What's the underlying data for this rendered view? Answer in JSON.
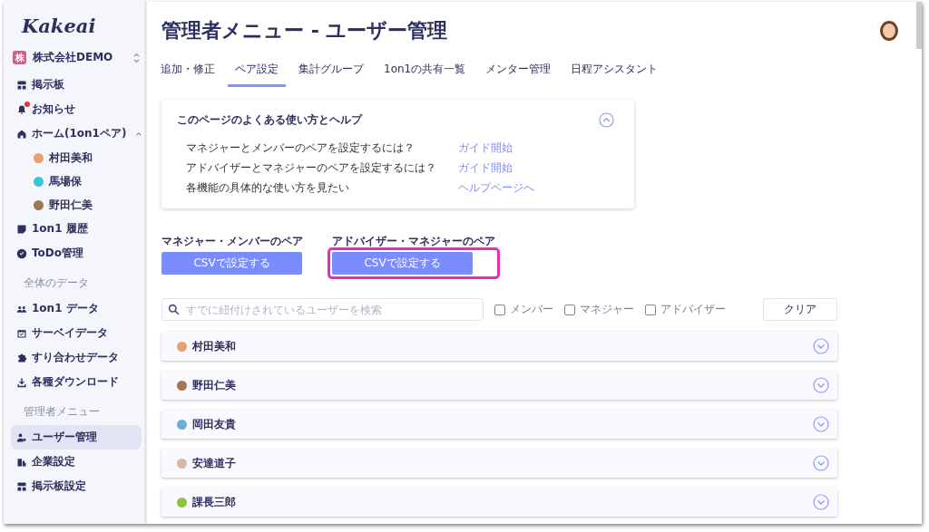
{
  "sidebar": {
    "logo": "Kakeai",
    "company": {
      "badge": "株",
      "name": "株式会社DEMO"
    },
    "items": [
      {
        "kind": "item",
        "label": "掲示板",
        "selected": false
      },
      {
        "kind": "item",
        "label": "お知らせ",
        "selected": false,
        "notification": true
      },
      {
        "kind": "item",
        "label": "ホーム(1on1ペア)",
        "selected": false,
        "expanded": true,
        "children": [
          {
            "label": "村田美和",
            "color": "#e8a070"
          },
          {
            "label": "馬場保",
            "color": "#3cc4d4"
          },
          {
            "label": "野田仁美",
            "color": "#a07850"
          }
        ]
      },
      {
        "kind": "item",
        "label": "1on1 履歴",
        "selected": false
      },
      {
        "kind": "item",
        "label": "ToDo管理",
        "selected": false
      },
      {
        "kind": "heading",
        "label": "全体のデータ"
      },
      {
        "kind": "item",
        "label": "1on1 データ",
        "selected": false
      },
      {
        "kind": "item",
        "label": "サーベイデータ",
        "selected": false
      },
      {
        "kind": "item",
        "label": "すり合わせデータ",
        "selected": false
      },
      {
        "kind": "item",
        "label": "各種ダウンロード",
        "selected": false
      },
      {
        "kind": "heading",
        "label": "管理者メニュー"
      },
      {
        "kind": "item",
        "label": "ユーザー管理",
        "selected": true
      },
      {
        "kind": "item",
        "label": "企業設定",
        "selected": false
      },
      {
        "kind": "item",
        "label": "掲示板設定",
        "selected": false
      }
    ]
  },
  "page_title": "管理者メニュー - ユーザー管理",
  "tabs": [
    {
      "label": "追加・修正",
      "selected": false
    },
    {
      "label": "ペア設定",
      "selected": true
    },
    {
      "label": "集計グループ",
      "selected": false
    },
    {
      "label": "1on1の共有一覧",
      "selected": false
    },
    {
      "label": "メンター管理",
      "selected": false
    },
    {
      "label": "日程アシスタント",
      "selected": false
    }
  ],
  "help": {
    "title": "このページのよくある使い方とヘルプ",
    "expanded": true,
    "rows": [
      {
        "question": "マネジャーとメンバーのペアを設定するには？",
        "link": "ガイド開始"
      },
      {
        "question": "アドバイザーとマネジャーのペアを設定するには？",
        "link": "ガイド開始"
      },
      {
        "question": "各機能の具体的な使い方を見たい",
        "link": "ヘルプページへ"
      }
    ]
  },
  "csv_sections": [
    {
      "title": "マネジャー・メンバーのペア",
      "button": "CSVで設定する",
      "highlighted": false
    },
    {
      "title": "アドバイザー・マネジャーのペア",
      "button": "CSVで設定する",
      "highlighted": true
    }
  ],
  "search": {
    "placeholder": "すでに紐付けされているユーザーを検索"
  },
  "filters": [
    {
      "label": "メンバー",
      "checked": false
    },
    {
      "label": "マネジャー",
      "checked": false
    },
    {
      "label": "アドバイザー",
      "checked": false
    }
  ],
  "clear_button": "クリア",
  "users": [
    {
      "name": "村田美和",
      "color": "#e8a070",
      "expanded": false
    },
    {
      "name": "野田仁美",
      "color": "#a07850",
      "expanded": false
    },
    {
      "name": "岡田友貴",
      "color": "#6ab0d8",
      "expanded": false
    },
    {
      "name": "安達道子",
      "color": "#d8b8a8",
      "expanded": false
    },
    {
      "name": "課長三郎",
      "color": "#8cc43c",
      "expanded": false
    }
  ]
}
